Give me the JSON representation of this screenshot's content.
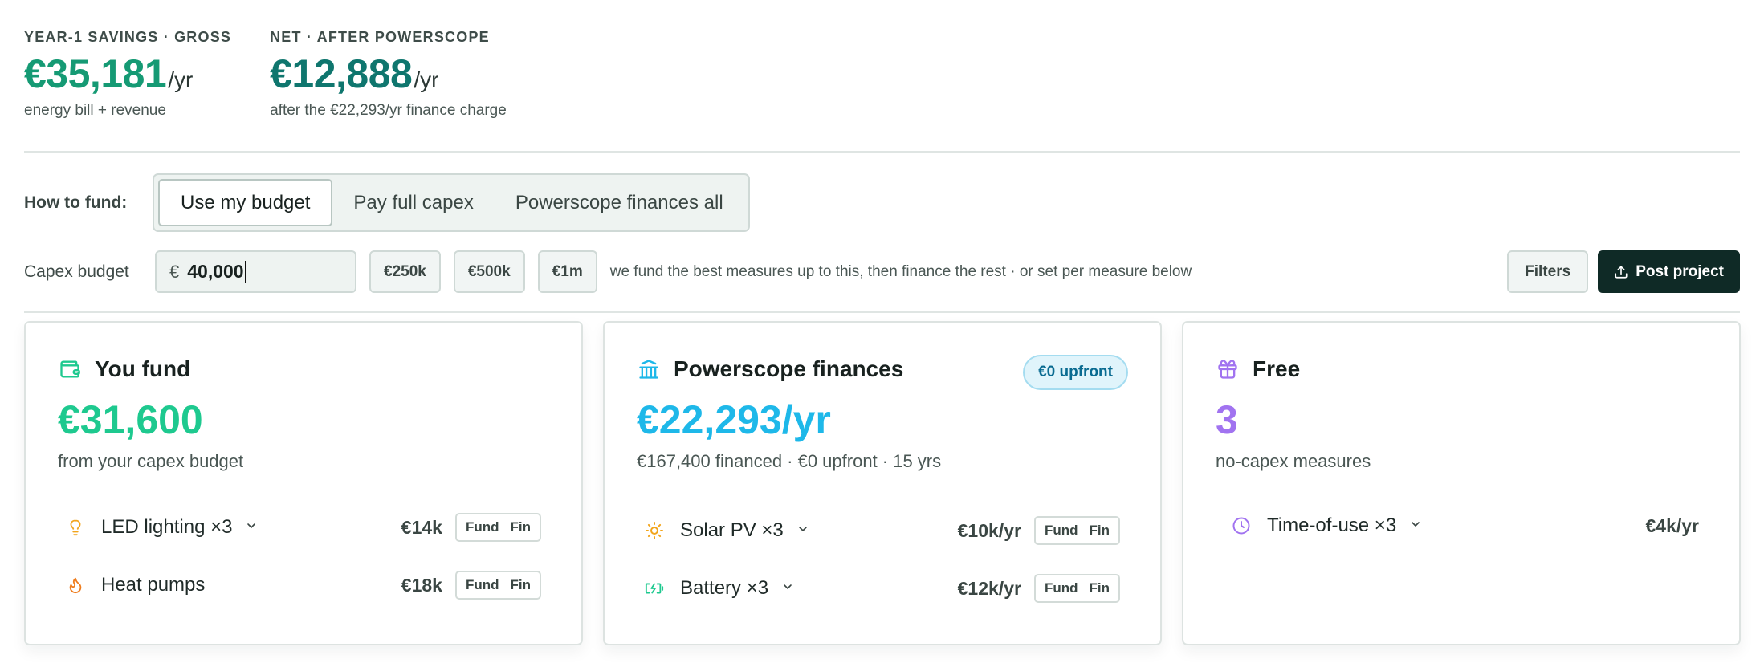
{
  "summary": {
    "gross": {
      "kicker": "YEAR-1 SAVINGS · GROSS",
      "amount": "€35,181",
      "unit": "/yr",
      "sub": "energy bill + revenue"
    },
    "net": {
      "kicker": "NET · AFTER POWERSCOPE",
      "amount": "€12,888",
      "unit": "/yr",
      "sub": "after the €22,293/yr finance charge"
    }
  },
  "funding": {
    "label": "How to fund:",
    "options": [
      "Use my budget",
      "Pay full capex",
      "Powerscope finances all"
    ],
    "selected": "Use my budget"
  },
  "budget": {
    "label": "Capex budget",
    "currency": "€",
    "value": "40,000",
    "presets": [
      "€250k",
      "€500k",
      "€1m"
    ],
    "hint": "we fund the best measures up to this, then finance the rest · or set per measure below",
    "filters_label": "Filters",
    "post_label": "Post project"
  },
  "cards": {
    "fund": {
      "title": "You fund",
      "icon": "wallet-icon",
      "amount": "€31,600",
      "desc": "from your capex budget",
      "measures": [
        {
          "name": "LED lighting ×3",
          "icon": "lightbulb-icon",
          "value": "€14k",
          "expandable": true
        },
        {
          "name": "Heat pumps",
          "icon": "flame-icon",
          "value": "€18k",
          "expandable": false
        }
      ]
    },
    "finance": {
      "title": "Powerscope finances",
      "icon": "bank-icon",
      "badge": "€0 upfront",
      "amount": "€22,293/yr",
      "desc": "€167,400 financed · €0 upfront · 15 yrs",
      "measures": [
        {
          "name": "Solar PV ×3",
          "icon": "sun-icon",
          "value": "€10k/yr",
          "expandable": true
        },
        {
          "name": "Battery ×3",
          "icon": "battery-charging-icon",
          "value": "€12k/yr",
          "expandable": true
        }
      ]
    },
    "free": {
      "title": "Free",
      "icon": "gift-icon",
      "amount": "3",
      "desc": "no-capex measures",
      "measures": [
        {
          "name": "Time-of-use ×3",
          "icon": "clock-icon",
          "value": "€4k/yr",
          "expandable": true
        }
      ]
    }
  },
  "toggle": {
    "fund": "Fund",
    "fin": "Fin"
  },
  "colors": {
    "gross": "#159a74",
    "net": "#0f766e",
    "fund": "#1ec98f",
    "finance": "#1eb8e9",
    "free": "#a173f0",
    "primary_button": "#0f2a26"
  }
}
